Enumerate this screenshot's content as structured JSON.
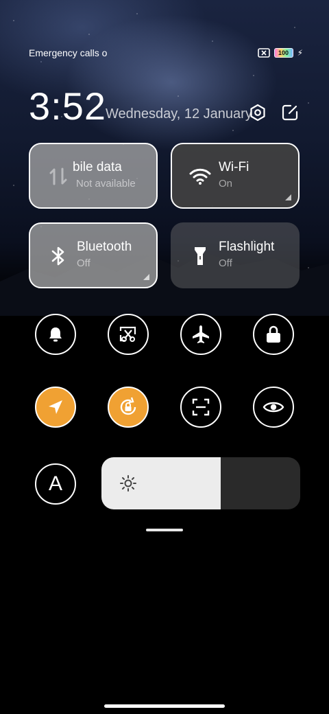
{
  "status_bar": {
    "left_text": "Emergency calls o",
    "battery_level": "100"
  },
  "header": {
    "time": "3:52",
    "date": "Wednesday, 12 January",
    "settings_icon": "settings-hex-icon",
    "edit_icon": "edit-icon"
  },
  "tiles": [
    {
      "title": "bile data",
      "subtitle": "Not available",
      "icon": "mobile-data-icon",
      "state": "disabled"
    },
    {
      "title": "Wi-Fi",
      "subtitle": "On",
      "icon": "wifi-icon",
      "state": "on"
    },
    {
      "title": "Bluetooth",
      "subtitle": "Off",
      "icon": "bluetooth-icon",
      "state": "off"
    },
    {
      "title": "Flashlight",
      "subtitle": "Off",
      "icon": "flashlight-icon",
      "state": "off"
    }
  ],
  "toggles": [
    {
      "icon": "bell-icon",
      "active": false
    },
    {
      "icon": "screenshot-icon",
      "active": false
    },
    {
      "icon": "airplane-icon",
      "active": false
    },
    {
      "icon": "lock-icon",
      "active": false
    },
    {
      "icon": "location-icon",
      "active": true
    },
    {
      "icon": "rotation-lock-icon",
      "active": true
    },
    {
      "icon": "scan-icon",
      "active": false
    },
    {
      "icon": "eye-icon",
      "active": false
    },
    {
      "icon": "auto-brightness-icon",
      "active": false,
      "label": "A"
    }
  ],
  "brightness": {
    "level": 0.6,
    "icon": "sun-icon"
  },
  "colors": {
    "accent": "#f0a133"
  }
}
